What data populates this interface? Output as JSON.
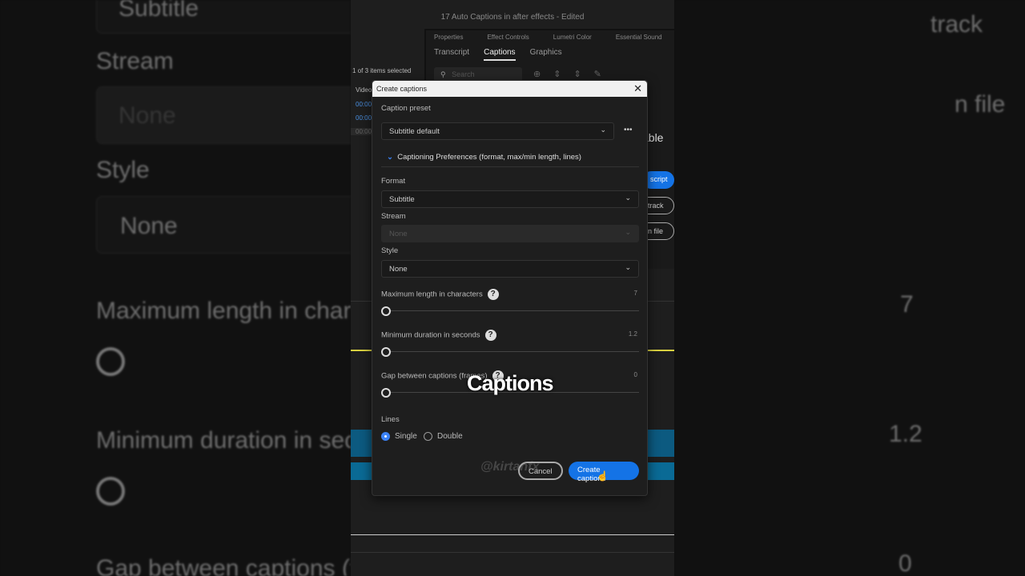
{
  "window_title": "17 Auto Captions in after effects - Edited",
  "panel_tabs": [
    "Properties",
    "Effect Controls",
    "Lumetri Color",
    "Essential Sound"
  ],
  "panel_tabs2": [
    "Transcript",
    "Captions",
    "Graphics"
  ],
  "search_placeholder": "Search",
  "selection": "1 of 3 items selected",
  "video_label": "Video",
  "timecodes": [
    "00:00",
    "00:00",
    "00:00"
  ],
  "bg_right": {
    "able": "able",
    "script": "script",
    "track": "track",
    "file": "n file"
  },
  "dialog": {
    "title": "Create captions",
    "preset_label": "Caption preset",
    "preset_value": "Subtitle default",
    "more": "•••",
    "prefs_title": "Captioning Preferences",
    "prefs_sub": " (format, max/min length, lines)",
    "format_label": "Format",
    "format_value": "Subtitle",
    "stream_label": "Stream",
    "stream_value": "None",
    "style_label": "Style",
    "style_value": "None",
    "max_label": "Maximum length in characters",
    "max_value": "7",
    "min_label": "Minimum duration in seconds",
    "min_value": "1.2",
    "gap_label": "Gap between captions (frames)",
    "gap_value": "0",
    "lines_label": "Lines",
    "single": "Single",
    "double": "Double",
    "cancel": "Cancel",
    "create": "Create captions"
  },
  "overlay_caption": "Captions",
  "watermark": "@kirtanfx"
}
